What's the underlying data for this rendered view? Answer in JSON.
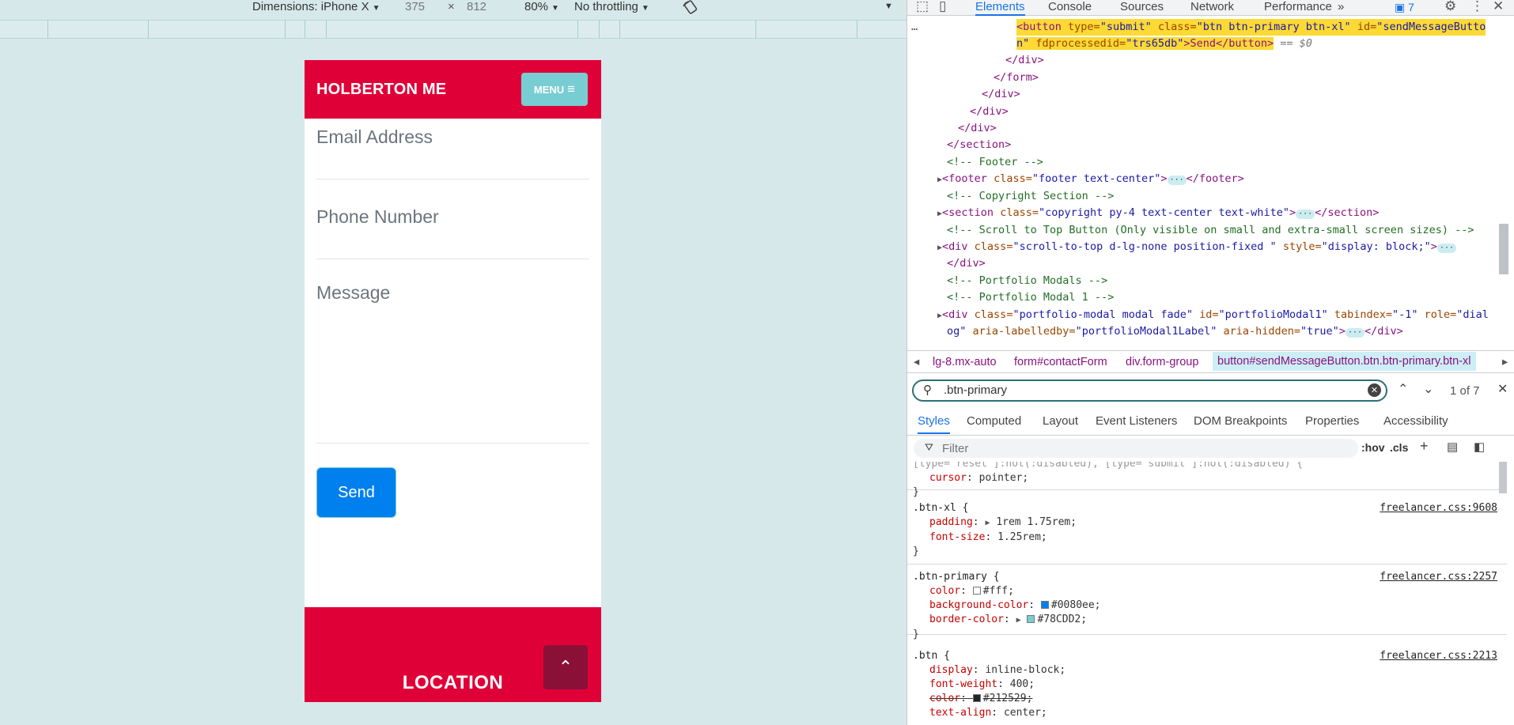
{
  "device_toolbar": {
    "dimensions": "Dimensions: iPhone X",
    "width": "375",
    "times": "×",
    "height": "812",
    "zoom": "80%",
    "throttling": "No throttling"
  },
  "phone": {
    "brand": "HOLBERTON ME",
    "menu_label": "MENU",
    "menu_icon": "≡",
    "email_placeholder": "Email Address",
    "phone_placeholder": "Phone Number",
    "message_placeholder": "Message",
    "send_label": "Send",
    "footer_heading": "LOCATION",
    "scroll_top_icon": "⌃"
  },
  "devtools": {
    "tabs": [
      "Elements",
      "Console",
      "Sources",
      "Network",
      "Performance"
    ],
    "more_tabs": "»",
    "issues": "7",
    "tree": {
      "l1_tag_open": "<button",
      "l1_attr1": " type=",
      "l1_val1": "\"submit\"",
      "l1_attr2": " class=",
      "l1_val2": "\"btn btn-primary btn-xl\"",
      "l1_attr3": " id=",
      "l1_val3": "\"sendMessageButto",
      "l2_val3": "n\"",
      "l2_attr4": " fdprocessedid=",
      "l2_val4": "\"trs65db\"",
      "l2_text": ">Send</button>",
      "l2_eq": " == $0",
      "close_div": "</div>",
      "close_form": "</form>",
      "close_section": "</section>",
      "comment_footer": "<!-- Footer -->",
      "footer_open": "<footer",
      "footer_attr": " class=",
      "footer_val": "\"footer text-center\"",
      "footer_close": "</footer>",
      "comment_copyright": "<!-- Copyright Section -->",
      "section_open": "<section",
      "section_val": "\"copyright py-4 text-center text-white\"",
      "comment_scroll": "<!-- Scroll to Top Button (Only visible on small and extra-small screen sizes) -->",
      "div_open": "<div",
      "scroll_val": "\"scroll-to-top d-lg-none position-fixed \"",
      "style_attr": " style=",
      "style_val": "\"display: block;\"",
      "comment_modals": "<!-- Portfolio Modals -->",
      "comment_modal1": "<!-- Portfolio Modal 1 -->",
      "modal_val1": "\"portfolio-modal modal fade\"",
      "id_attr": " id=",
      "modal_id": "\"portfolioModal1\"",
      "tabindex_attr": " tabindex=",
      "tabindex_val": "\"-1\"",
      "role_attr": " role=",
      "role_val1": "\"dial",
      "role_val2": "og\"",
      "labelledby_attr": " aria-labelledby=",
      "labelledby_val": "\"portfolioModal1Label\"",
      "hidden_attr": " aria-hidden=",
      "hidden_val": "\"true\"",
      "gt": ">",
      "ellipsis": "···"
    },
    "breadcrumbs": [
      "lg-8.mx-auto",
      "form#contactForm",
      "div.form-group",
      "button#sendMessageButton.btn.btn-primary.btn-xl"
    ],
    "search": {
      "value": ".btn-primary",
      "result": "1 of 7"
    },
    "styles_tabs": [
      "Styles",
      "Computed",
      "Layout",
      "Event Listeners",
      "DOM Breakpoints",
      "Properties",
      "Accessibility"
    ],
    "filter": {
      "placeholder": "Filter",
      "hov": ":hov",
      "cls": ".cls"
    },
    "rules": {
      "top_prop": "cursor",
      "top_val": "pointer;",
      "top_sel": "[type=\"reset\"]:not(:disabled), [type=\"submit\"]:not(:disabled) {",
      "btnxl_sel": ".btn-xl {",
      "btnxl_src": "freelancer.css:9608",
      "padding": "padding",
      "padding_val": "1rem 1.75rem;",
      "fontsize": "font-size",
      "fontsize_val": "1.25rem;",
      "btnprimary_sel": ".btn-primary {",
      "btnprimary_src": "freelancer.css:2257",
      "color": "color",
      "color_val": "#fff;",
      "bg": "background-color",
      "bg_val": "#0080ee;",
      "border": "border-color",
      "border_val": "#78CDD2;",
      "btn_sel": ".btn {",
      "btn_src": "freelancer.css:2213",
      "display": "display",
      "display_val": "inline-block;",
      "weight": "font-weight",
      "weight_val": "400;",
      "color2_val": "#212529;",
      "align": "text-align",
      "align_val": "center;",
      "close": "}"
    },
    "colors": {
      "white": "#ffffff",
      "primary": "#0080ee",
      "teal": "#78CDD2",
      "dark": "#212529"
    }
  }
}
